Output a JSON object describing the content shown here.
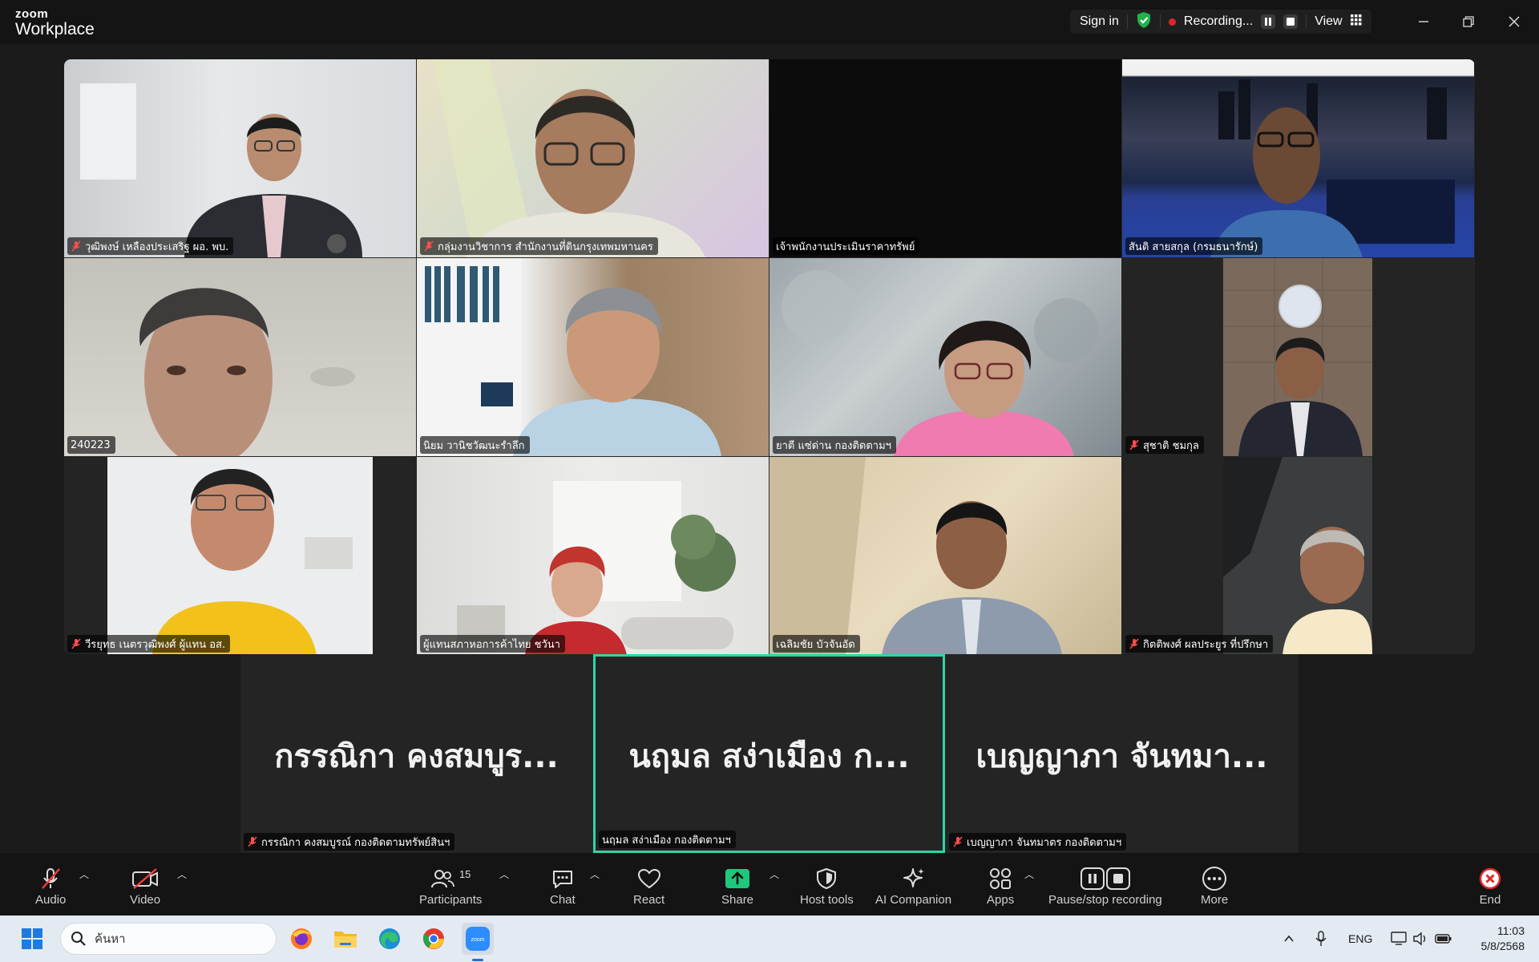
{
  "app": {
    "logo_line1": "zoom",
    "logo_line2": "Workplace"
  },
  "titlebar": {
    "sign_in": "Sign in",
    "recording_label": "Recording...",
    "view_label": "View"
  },
  "video_tiles": [
    {
      "name": "วุฒิพงษ์ เหลืองประเสริฐ ผอ. พบ.",
      "muted": true
    },
    {
      "name": "กลุ่มงานวิชาการ สำนักงานที่ดินกรุงเทพมหานคร",
      "muted": true
    },
    {
      "name": "เจ้าพนักงานประเมินราคาทรัพย์",
      "muted": false
    },
    {
      "name": "สันติ สายสกุล (กรมธนารักษ์)",
      "muted": false
    },
    {
      "name": "240223",
      "muted": false
    },
    {
      "name": "นิยม วานิชวัฒนะรำลึก",
      "muted": false
    },
    {
      "name": "ยาตี แซ่ด่าน กองติดตามฯ",
      "muted": false
    },
    {
      "name": "สุชาติ ชมกุล",
      "muted": true
    },
    {
      "name": "วีรยุทธ เนตรวุฒิพงศ์ ผู้แทน อส.",
      "muted": true
    },
    {
      "name": "ผู้แทนสภาหอการค้าไทย ชวันา",
      "muted": false
    },
    {
      "name": "เฉลิมชัย บัวจันอัด",
      "muted": false
    },
    {
      "name": "กิตติพงศ์ ผลประยูร ที่ปรึกษา",
      "muted": true
    }
  ],
  "avatar_tiles": [
    {
      "big": "กรรณิกา คงสมบูร...",
      "name": "กรรณิกา คงสมบูรณ์ กองติดตามทรัพย์สินฯ",
      "muted": true,
      "active": false
    },
    {
      "big": "นฤมล สง่าเมือง ก...",
      "name": "นฤมล สง่าเมือง กองติดตามฯ",
      "muted": false,
      "active": true
    },
    {
      "big": "เบญญาภา จันทมา...",
      "name": "เบญญาภา จันทมาตร กองติดตามฯ",
      "muted": true,
      "active": false
    }
  ],
  "toolbar": {
    "audio": "Audio",
    "video": "Video",
    "participants": "Participants",
    "participants_count": "15",
    "chat": "Chat",
    "react": "React",
    "share": "Share",
    "host_tools": "Host tools",
    "ai_companion": "AI Companion",
    "apps": "Apps",
    "pause_stop": "Pause/stop recording",
    "more": "More",
    "end": "End"
  },
  "taskbar": {
    "search_placeholder": "ค้นหา",
    "language": "ENG",
    "time": "11:03",
    "date": "5/8/2568"
  },
  "colors": {
    "accent_green": "#2ed5a7",
    "record_red": "#e0262b",
    "share_green": "#1ec77b",
    "end_red": "#e02828"
  }
}
